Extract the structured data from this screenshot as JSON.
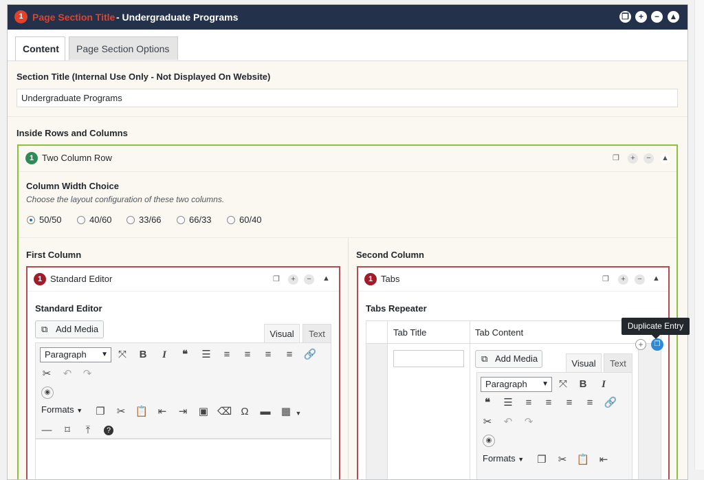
{
  "header": {
    "number": "1",
    "title_highlight": "Page Section Title",
    "title_rest": " - Undergraduate Programs"
  },
  "tabs": [
    {
      "label": "Content"
    },
    {
      "label": "Page Section Options"
    }
  ],
  "section": {
    "title_label": "Section Title (Internal Use Only - Not Displayed On Website)",
    "title_value": "Undergraduate Programs",
    "inside_label": "Inside Rows and Columns"
  },
  "row": {
    "number": "1",
    "title": "Two Column Row",
    "width_label": "Column Width Choice",
    "width_help": "Choose the layout configuration of these two columns.",
    "options": [
      "50/50",
      "40/60",
      "33/66",
      "66/33",
      "60/40"
    ],
    "selected": "50/50"
  },
  "first_column": {
    "label": "First Column",
    "block_number": "1",
    "block_title": "Standard Editor",
    "editor_label": "Standard Editor",
    "add_media": "Add Media",
    "visual_tab": "Visual",
    "text_tab": "Text",
    "format_select": "Paragraph",
    "formats_menu": "Formats"
  },
  "second_column": {
    "label": "Second Column",
    "block_number": "1",
    "block_title": "Tabs",
    "repeater_label": "Tabs Repeater",
    "col_tab_title": "Tab Title",
    "col_tab_content": "Tab Content",
    "add_media": "Add Media",
    "visual_tab": "Visual",
    "text_tab": "Text",
    "format_select": "Paragraph",
    "formats_menu": "Formats",
    "tooltip": "Duplicate Entry"
  },
  "colors": {
    "header_bg": "#23324a",
    "accent_red": "#e2412b",
    "row_green": "#8ac23b",
    "badge_green": "#2e8b57",
    "block_red": "#b34c51",
    "badge_red": "#a01c2b",
    "duplicate_blue": "#2f8ad6"
  }
}
